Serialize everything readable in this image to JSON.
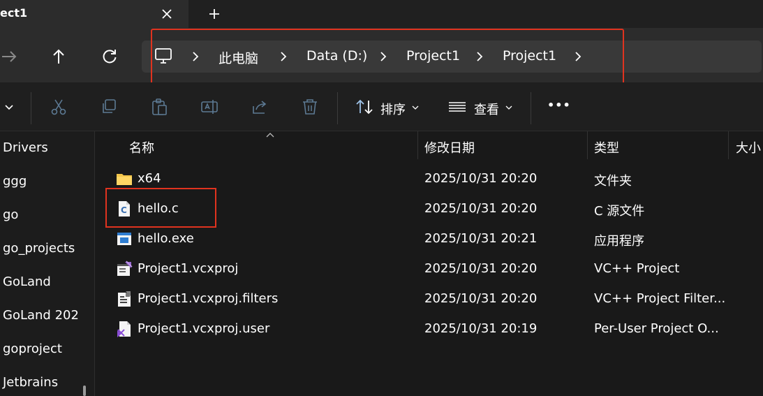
{
  "tab": {
    "title": "ect1"
  },
  "address": {
    "crumbs": [
      "此电脑",
      "Data (D:)",
      "Project1",
      "Project1"
    ]
  },
  "commandbar": {
    "sort_label": "排序",
    "view_label": "查看",
    "more_label": "•••"
  },
  "sidebar": {
    "items": [
      "Drivers",
      "ggg",
      "go",
      "go_projects",
      "GoLand",
      "GoLand 202",
      "goproject",
      "Jetbrains"
    ]
  },
  "columns": {
    "name": "名称",
    "modified": "修改日期",
    "type": "类型",
    "size": "大小"
  },
  "files": [
    {
      "name": "x64",
      "modified": "2025/10/31 20:20",
      "type": "文件夹",
      "icon": "folder-icon"
    },
    {
      "name": "hello.c",
      "modified": "2025/10/31 20:20",
      "type": "C 源文件",
      "icon": "c-source-file-icon"
    },
    {
      "name": "hello.exe",
      "modified": "2025/10/31 20:21",
      "type": "应用程序",
      "icon": "exe-file-icon"
    },
    {
      "name": "Project1.vcxproj",
      "modified": "2025/10/31 20:20",
      "type": "VC++ Project",
      "icon": "vcxproj-file-icon"
    },
    {
      "name": "Project1.vcxproj.filters",
      "modified": "2025/10/31 20:20",
      "type": "VC++ Project Filter...",
      "icon": "filters-file-icon"
    },
    {
      "name": "Project1.vcxproj.user",
      "modified": "2025/10/31 20:19",
      "type": "Per-User Project O...",
      "icon": "vs-user-file-icon"
    }
  ],
  "colors": {
    "highlight": "#e0331f",
    "background": "#191919",
    "folder": "#f3c54a"
  }
}
